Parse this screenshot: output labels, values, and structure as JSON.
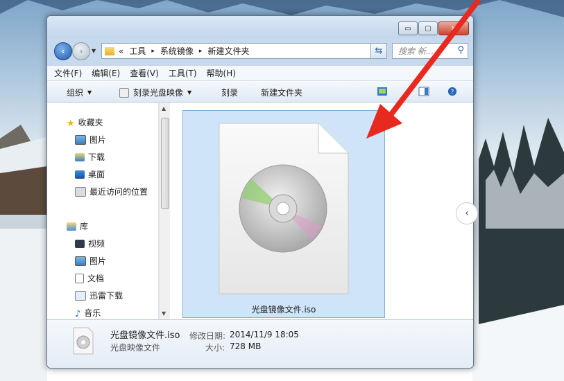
{
  "window": {
    "caption_minimize": "▭",
    "caption_maximize": "▢",
    "caption_close": "✕"
  },
  "address": {
    "overflow": "«",
    "crumbs": [
      "工具",
      "系统镜像",
      "新建文件夹"
    ],
    "separator": "▸"
  },
  "search": {
    "placeholder": "搜索 新..."
  },
  "menu": {
    "items": [
      "文件(F)",
      "编辑(E)",
      "查看(V)",
      "工具(T)",
      "帮助(H)"
    ]
  },
  "toolbar": {
    "organize": "组织",
    "burn_image": "刻录光盘映像",
    "burn": "刻录",
    "new_folder": "新建文件夹"
  },
  "nav": {
    "favorites": "收藏夹",
    "fav_items": [
      "图片",
      "下载",
      "桌面",
      "最近访问的位置"
    ],
    "library": "库",
    "lib_items": [
      "视频",
      "图片",
      "文档",
      "迅雷下载",
      "音乐"
    ]
  },
  "file": {
    "name": "光盘镜像文件.iso",
    "type": "光盘映像文件",
    "modified_label": "修改日期:",
    "modified": "2014/11/9 18:05",
    "size_label": "大小:",
    "size": "728 MB"
  },
  "colors": {
    "arrow": "#e8291f",
    "selection": "#cfe3f9"
  }
}
